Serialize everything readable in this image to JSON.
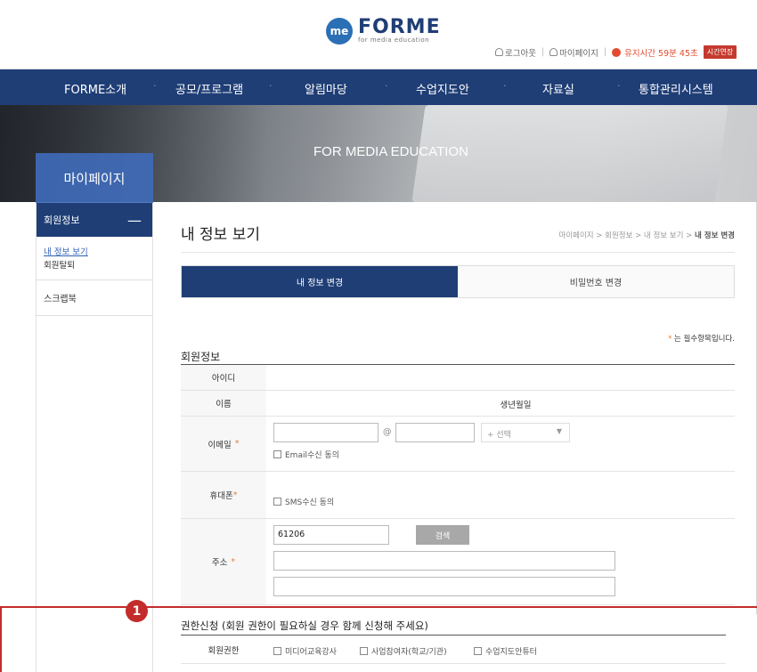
{
  "header": {
    "logo_mark": "me",
    "logo_title": "FORME",
    "logo_subtitle": "for media education",
    "logout": "로그아웃",
    "mypage": "마이페이지",
    "timer_label": "유지시간 59분 45초",
    "extend_button": "시간연장"
  },
  "nav": {
    "items": [
      "FORME소개",
      "공모/프로그램",
      "알림마당",
      "수업지도안",
      "자료실",
      "통합관리시스템"
    ]
  },
  "hero": {
    "title": "FOR MEDIA EDUCATION",
    "section_name": "마이페이지"
  },
  "sidebar": {
    "head": "회원정보",
    "head_toggle": "—",
    "sub_items": [
      "내 정보 보기",
      "회원탈퇴"
    ],
    "other_item": "스크랩북"
  },
  "main": {
    "page_title": "내 정보 보기",
    "breadcrumb_prefix": "마이페이지 > 회원정보 > 내 정보 보기 > ",
    "breadcrumb_current": "내 정보 변경",
    "tabs": [
      "내 정보 변경",
      "비밀번호 변경"
    ],
    "required_star": "*",
    "required_note": " 는 필수항목입니다.",
    "section_title": "회원정보",
    "fields": {
      "id_label": "아이디",
      "name_label": "이름",
      "birth_label": "생년월일",
      "email_label": "이메일",
      "email_at": "@",
      "email_select": "+ 선택",
      "email_consent": "Email수신 동의",
      "phone_label": "휴대폰",
      "sms_consent": "SMS수신 동의",
      "address_label": "주소",
      "zip_value": "61206",
      "search_button": "검색"
    }
  },
  "permission": {
    "badge": "1",
    "title": "권한신청 (회원 권한이 필요하실 경우 함께 신청해 주세요)",
    "row_label": "회원권한",
    "options": [
      "미디어교육강사",
      "사업참여자(학교/기관)",
      "수업지도안튜터"
    ]
  },
  "colors": {
    "navy": "#1f3e76",
    "accent_blue": "#3f6cba",
    "highlight_red": "#c42b2b",
    "timer_red": "#e34b2e",
    "required_orange": "#e7823a"
  }
}
